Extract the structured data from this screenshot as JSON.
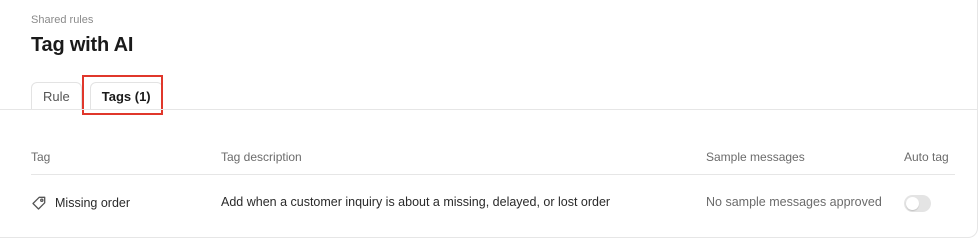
{
  "header": {
    "breadcrumb": "Shared rules",
    "title": "Tag with AI"
  },
  "tabs": [
    {
      "label": "Rule",
      "active": false
    },
    {
      "label": "Tags (1)",
      "active": true
    }
  ],
  "table": {
    "columns": {
      "tag": "Tag",
      "description": "Tag description",
      "sample": "Sample messages",
      "auto": "Auto tag"
    },
    "rows": [
      {
        "tag": "Missing order",
        "icon": "tag-icon",
        "description": "Add when a customer inquiry is about a missing, delayed, or lost order",
        "sample": "No sample messages approved",
        "auto_tag": false
      }
    ]
  },
  "colors": {
    "highlight": "#e0372b",
    "toggle_off": "#e4e4e4"
  }
}
